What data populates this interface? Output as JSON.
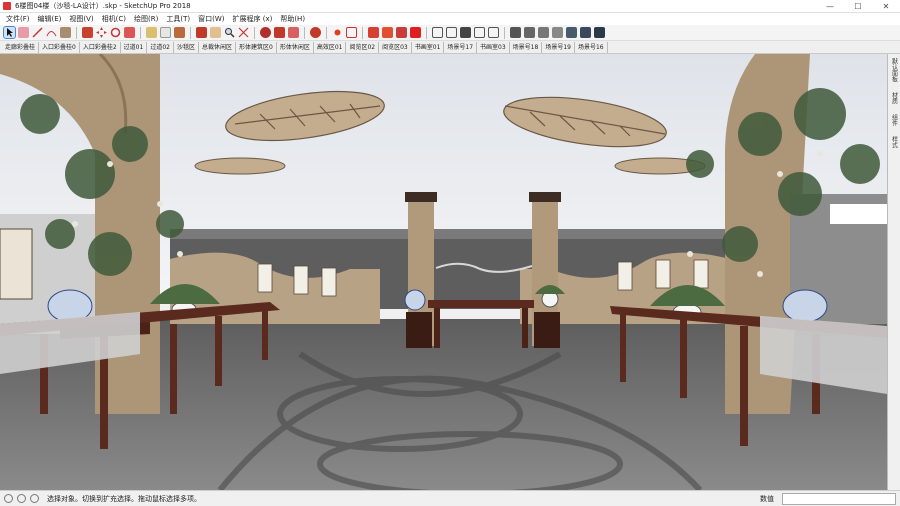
{
  "window": {
    "title": "6楼图04楼（沙毯-LA设计）.skp - SketchUp Pro 2018",
    "minimize": "—",
    "maximize": "☐",
    "close": "✕"
  },
  "menu": [
    "文件(F)",
    "编辑(E)",
    "视图(V)",
    "相机(C)",
    "绘图(R)",
    "工具(T)",
    "窗口(W)",
    "扩展程序 (x)",
    "帮助(H)"
  ],
  "scenes": [
    "走廊彩叠桂",
    "入口彩叠桂0",
    "入口彩叠桂2",
    "过道01",
    "过道02",
    "沙毯区",
    "总裁休闲区",
    "形体建筑区0",
    "形体休闲区",
    "高效区01",
    "阅览区02",
    "阅览区03",
    "书画室01",
    "场景号17",
    "书画室03",
    "场景号18",
    "场景号19",
    "场景号16"
  ],
  "side_tabs": [
    "默认面板",
    "材质",
    "组件",
    "样式"
  ],
  "status": {
    "message": "选择对象。切换到扩充选择。拖动鼠标选择多项。",
    "measure_label": "数值",
    "measure_value": ""
  },
  "colors": {
    "accent": "#4a88d0",
    "sky": "#e4e7ec",
    "wood": "#b49c7e",
    "table": "#5a2a1e",
    "floor": "#6c6c6c"
  }
}
